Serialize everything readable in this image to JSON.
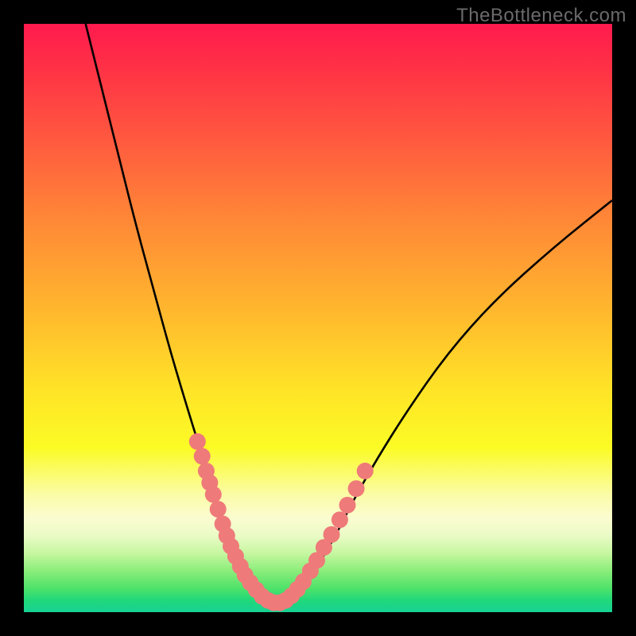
{
  "watermark": "TheBottleneck.com",
  "chart_data": {
    "type": "line",
    "title": "",
    "xlabel": "",
    "ylabel": "",
    "xrange": [
      0,
      100
    ],
    "yrange": [
      0,
      100
    ],
    "grid": false,
    "series": [
      {
        "name": "main-curve",
        "color": "#000000",
        "x": [
          10.5,
          13,
          16,
          19,
          22,
          25,
          28,
          30.5,
          32.5,
          34,
          35.5,
          37,
          38.5,
          40,
          42,
          44,
          46,
          48,
          50,
          53,
          56,
          60,
          65,
          72,
          80,
          90,
          100
        ],
        "y": [
          100,
          90,
          78,
          66,
          55,
          44,
          34,
          26,
          20,
          15,
          11,
          7.5,
          5,
          3,
          1.5,
          1.5,
          3,
          5,
          8,
          13,
          19,
          26,
          34,
          44,
          53,
          62,
          70
        ]
      },
      {
        "name": "marker-dots",
        "color": "#ef7a7a",
        "type": "scatter",
        "x": [
          29.5,
          30.3,
          31,
          31.6,
          32.2,
          33,
          33.8,
          34.5,
          35.2,
          36,
          36.8,
          37.6,
          38.5,
          39.5,
          40.5,
          41.5,
          42.5,
          43.5,
          44.5,
          45.5,
          46.5,
          47.5,
          48.7,
          49.8,
          51,
          52.3,
          53.7,
          55,
          56.5,
          58
        ],
        "y": [
          29,
          26.5,
          24,
          22,
          20,
          17.5,
          15,
          13,
          11.2,
          9.5,
          7.8,
          6.3,
          5,
          3.8,
          2.7,
          2,
          1.6,
          1.6,
          2,
          2.8,
          3.9,
          5.2,
          7,
          8.8,
          11,
          13.2,
          15.7,
          18.2,
          21,
          24
        ]
      }
    ],
    "gradient_stops": [
      {
        "pct": 0,
        "color": "#ff1a4e"
      },
      {
        "pct": 8,
        "color": "#ff3345"
      },
      {
        "pct": 20,
        "color": "#ff5a3f"
      },
      {
        "pct": 34,
        "color": "#ff8a36"
      },
      {
        "pct": 48,
        "color": "#ffb52e"
      },
      {
        "pct": 62,
        "color": "#ffe327"
      },
      {
        "pct": 72,
        "color": "#fbfb25"
      },
      {
        "pct": 80,
        "color": "#fbfca6"
      },
      {
        "pct": 84,
        "color": "#fbfcd0"
      },
      {
        "pct": 87,
        "color": "#eafbc6"
      },
      {
        "pct": 90,
        "color": "#c6f7a0"
      },
      {
        "pct": 93,
        "color": "#8aed7a"
      },
      {
        "pct": 96,
        "color": "#4de26a"
      },
      {
        "pct": 98,
        "color": "#21d87a"
      },
      {
        "pct": 100,
        "color": "#17d294"
      }
    ]
  }
}
